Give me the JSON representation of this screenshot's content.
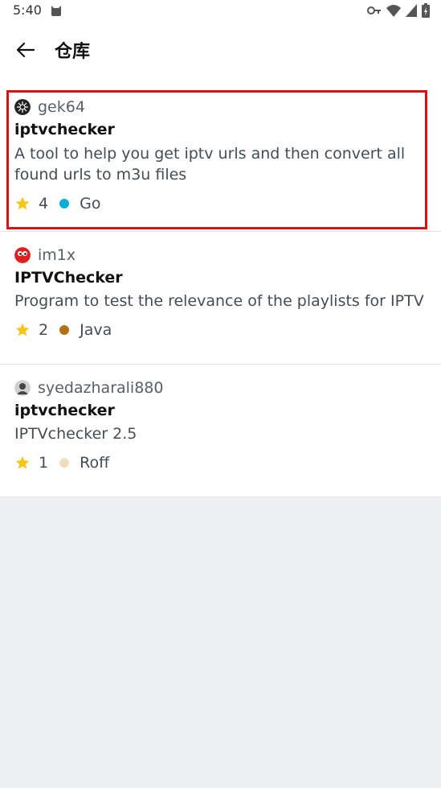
{
  "status_bar": {
    "time": "5:40"
  },
  "app_bar": {
    "title": "仓库"
  },
  "repos": [
    {
      "owner": "gek64",
      "name": "iptvchecker",
      "description": "A tool to help you get iptv urls and then convert all found urls to m3u files",
      "stars": "4",
      "language": "Go",
      "language_color": "#00add8",
      "avatar_icon": "gek64-avatar-icon"
    },
    {
      "owner": "im1x",
      "name": "IPTVChecker",
      "description": "Program to test the relevance of the playlists for IPTV",
      "stars": "2",
      "language": "Java",
      "language_color": "#b07219",
      "avatar_icon": "im1x-avatar-icon"
    },
    {
      "owner": "syedazharali880",
      "name": "iptvchecker",
      "description": "IPTVchecker 2.5",
      "stars": "1",
      "language": "Roff",
      "language_color": "#ecdebe",
      "avatar_icon": "syedazharali880-avatar-icon"
    }
  ],
  "colors": {
    "star": "#f5c518",
    "highlight": "#e01010",
    "background": "#eeeff3"
  }
}
